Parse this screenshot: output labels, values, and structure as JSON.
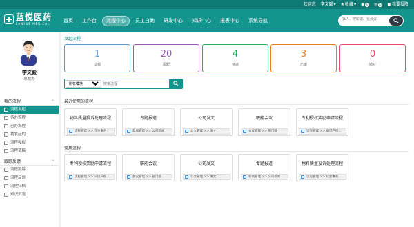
{
  "topbar": {
    "greeting": "欢迎您",
    "user": "李文毅",
    "favorites": "收藏",
    "msg_count": "0",
    "mail_count": "0",
    "feedback": "我要投降"
  },
  "logo": {
    "name_cn": "蓝悦医药",
    "name_en": "LANYUE MEDICAL"
  },
  "nav": [
    "首页",
    "工作台",
    "流程中心",
    "员工自助",
    "研发中心",
    "知识中心",
    "报表中心",
    "系统导航"
  ],
  "search": {
    "placeholder": "找人、搜知识、看会议"
  },
  "profile": {
    "name": "李文毅",
    "title": "总裁办"
  },
  "sidebar": {
    "group1": "我的流程",
    "group1_items": [
      "流程发起",
      "待办流程",
      "已办流程",
      "我发起的",
      "流程授权",
      "流程草稿"
    ],
    "group2": "跟踪反馈",
    "group2_items": [
      "流程跟踪",
      "流程反馈",
      "流程归档",
      "知识沉淀"
    ]
  },
  "content": {
    "start_title": "发起流程",
    "stats": [
      {
        "num": "1",
        "label": "草稿",
        "color": "#5b9bd5"
      },
      {
        "num": "20",
        "label": "跟起",
        "color": "#9b59b6"
      },
      {
        "num": "4",
        "label": "待审",
        "color": "#27ae60"
      },
      {
        "num": "3",
        "label": "已审",
        "color": "#e67e22"
      },
      {
        "num": "0",
        "label": "撤并",
        "color": "#e84c6d"
      }
    ],
    "filter": {
      "select_value": "所有模块",
      "input_placeholder": "搜索流程"
    },
    "recent_title": "最近使用的流程",
    "recent": [
      {
        "name": "物料质量投诉处理流程",
        "path": "流程管理 >> 综合事务"
      },
      {
        "name": "专题报道",
        "path": "新闻管理 >> 公司新闻"
      },
      {
        "name": "公司发文",
        "path": "公文管理 >> 发文"
      },
      {
        "name": "职能会议",
        "path": "会议管理 >> 部门级"
      },
      {
        "name": "专利授权奖励申请流程",
        "path": "流程管理 >> 知识产权..."
      }
    ],
    "common_title": "常用流程",
    "common": [
      {
        "name": "专利授权奖励申请流程",
        "path": "流程管理 >> 知识产权..."
      },
      {
        "name": "职能会议",
        "path": "会议管理 >> 部门级"
      },
      {
        "name": "公司发文",
        "path": "公文管理 >> 发文"
      },
      {
        "name": "专题报道",
        "path": "新闻管理 >> 公司新闻"
      },
      {
        "name": "物料质量投诉处理流程",
        "path": "流程管理 >> 综合事务"
      }
    ]
  }
}
